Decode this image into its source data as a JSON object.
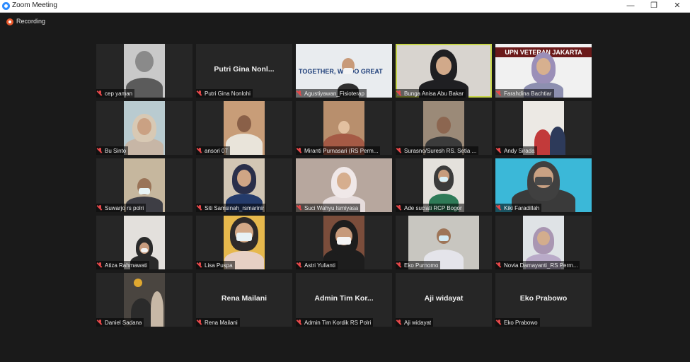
{
  "window": {
    "title": "Zoom Meeting",
    "minimize": "—",
    "maximize": "❐",
    "close": "✕"
  },
  "recording": {
    "label": "Recording"
  },
  "participants": [
    {
      "name": "cep yaman",
      "video": true
    },
    {
      "name": "Putri Gina Nonlohi",
      "display": "Putri Gina Nonl...",
      "video": false
    },
    {
      "name": "Agustiyawan_Fisioterap",
      "video": true,
      "banner": "TOGETHER, WE DO GREAT"
    },
    {
      "name": "Bunga Anisa Abu Bakar",
      "video": true,
      "active": true
    },
    {
      "name": "Farahdina Bachtiar",
      "video": true,
      "banner": "UPN VETERAN JAKARTA"
    },
    {
      "name": "Bu Sinto",
      "video": true
    },
    {
      "name": "ansori 07",
      "video": true
    },
    {
      "name": "Miranti Purnasari (RS Perm...",
      "video": true
    },
    {
      "name": "Surasno/Suresh RS. Setia ...",
      "video": true
    },
    {
      "name": "Andy Sirada",
      "video": true
    },
    {
      "name": "Suwarjo rs polri",
      "video": true
    },
    {
      "name": "Siti Samsinah_rsmarinir",
      "video": true
    },
    {
      "name": "Suci Wahyu Ismiyasa",
      "video": true
    },
    {
      "name": "Ade suciati RCP Bogor",
      "video": true
    },
    {
      "name": "Kiki Faradillah",
      "video": true
    },
    {
      "name": "Atiza Rahmawati",
      "video": true
    },
    {
      "name": "Lisa Puspa",
      "video": true
    },
    {
      "name": "Astri Yulianti",
      "video": true
    },
    {
      "name": "Eko Purnomo",
      "video": true
    },
    {
      "name": "Novia Damayanti_RS Perm...",
      "video": true
    },
    {
      "name": "Daniel Sadana",
      "video": true
    },
    {
      "name": "Rena Mailani",
      "display": "Rena Mailani",
      "video": false
    },
    {
      "name": "Admin Tim Kordik RS Polri",
      "display": "Admin Tim Kor...",
      "video": false
    },
    {
      "name": "Aji widayat",
      "display": "Aji widayat",
      "video": false
    },
    {
      "name": "Eko Prabowo",
      "display": "Eko Prabowo",
      "video": false
    }
  ]
}
